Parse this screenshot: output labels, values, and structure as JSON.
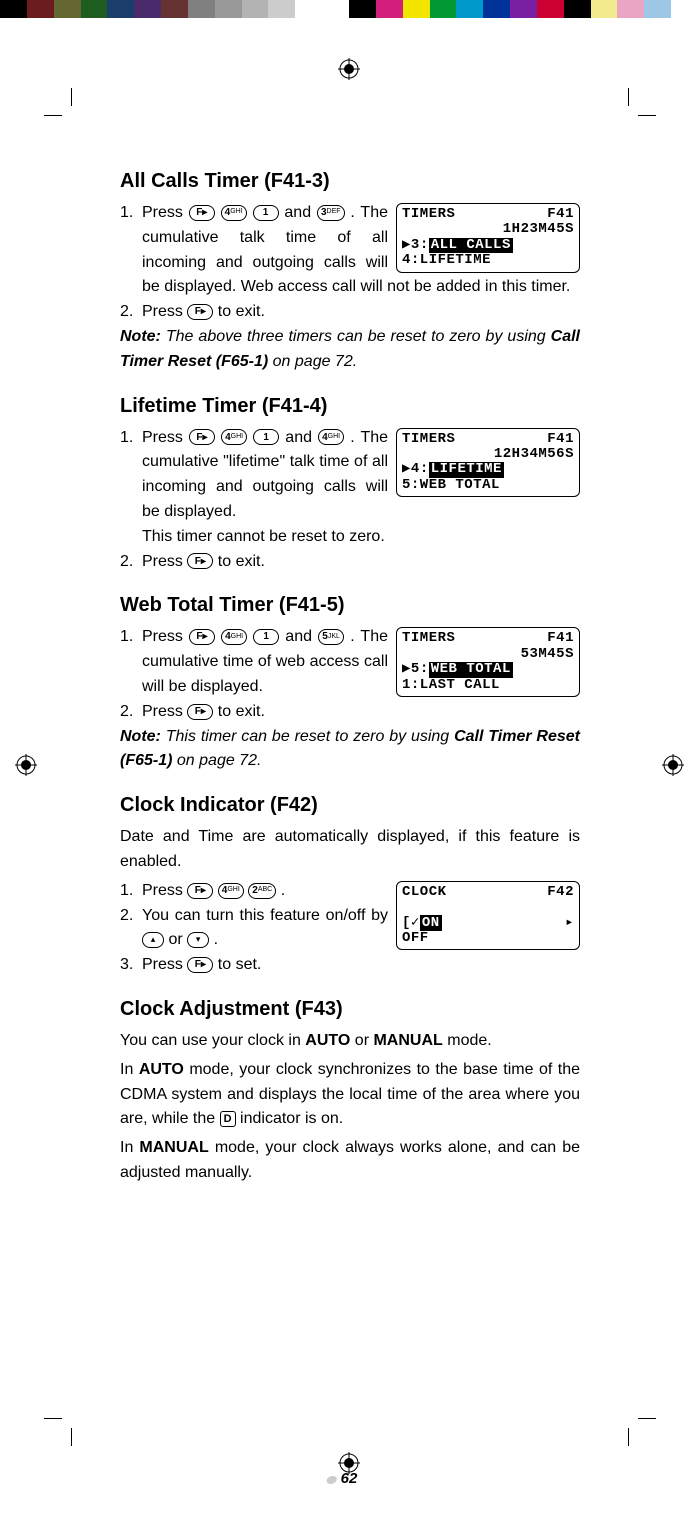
{
  "colorbar": [
    "#000000",
    "#6b1d1d",
    "#666633",
    "#1f5c1f",
    "#1a3d6b",
    "#4b2a6b",
    "#663333",
    "#808080",
    "#999999",
    "#b3b3b3",
    "#cccccc",
    "#ffffff",
    "#ffffff",
    "#000000",
    "#d21f7c",
    "#f2e600",
    "#009933",
    "#0099cc",
    "#003399",
    "#7a1fa2",
    "#cc0033",
    "#000000",
    "#f2ea8c",
    "#e8a6c4",
    "#9cc8e6",
    "#ffffff"
  ],
  "s1": {
    "title": "All Calls Timer (F41-3)",
    "step1a": "Press ",
    "step1b": " and ",
    "step1c": " . The cumulative talk time of all incoming and outgoing calls will be displayed. Web access call will not be added in this timer.",
    "step2a": "Press ",
    "step2b": " to exit.",
    "note_label": "Note:",
    "note_text": "  The above three timers can be reset to zero by using ",
    "note_bold": "Call Timer Reset (F65-1)",
    "note_tail": " on page 72.",
    "lcd": {
      "r1a": "TIMERS",
      "r1b": "F41",
      "r2": "1H23M45S",
      "r3p": "▶3:",
      "r3hl": "ALL CALLS",
      "r4": " 4:LIFETIME"
    }
  },
  "s2": {
    "title": "Lifetime Timer (F41-4)",
    "step1a": "Press ",
    "step1b": " and ",
    "step1c": " . The cumulative \"lifetime\" talk time of all incoming and outgoing calls will be displayed.",
    "step1d": "This timer cannot be reset to zero.",
    "step2a": "Press ",
    "step2b": " to exit.",
    "lcd": {
      "r1a": "TIMERS",
      "r1b": "F41",
      "r2": "12H34M56S",
      "r3p": "▶4:",
      "r3hl": "LIFETIME",
      "r4": " 5:WEB TOTAL"
    }
  },
  "s3": {
    "title": "Web Total Timer (F41-5)",
    "step1a": "Press ",
    "step1b": " and ",
    "step1c": " . The cumulative time of web access call will be displayed.",
    "step2a": "Press ",
    "step2b": " to exit.",
    "note_label": "Note:",
    "note_text": " This timer can be reset to zero by using ",
    "note_bold": "Call Timer Reset (F65-1)",
    "note_tail": " on page 72.",
    "lcd": {
      "r1a": "TIMERS",
      "r1b": "F41",
      "r2": "53M45S",
      "r3p": "▶5:",
      "r3hl": "WEB TOTAL",
      "r4": " 1:LAST CALL"
    }
  },
  "s4": {
    "title": "Clock Indicator (F42)",
    "intro": "Date and Time are automatically displayed, if this feature is enabled.",
    "step1a": "Press ",
    "step1b": " .",
    "step2a": "You can turn this feature on/off by ",
    "step2b": " or ",
    "step2c": " .",
    "step3a": "Press ",
    "step3b": " to set.",
    "lcd": {
      "r1a": "CLOCK",
      "r1b": "F42",
      "r3a": "[✓",
      "r3hl": "ON",
      "r3b": "▸",
      "r4": "  OFF"
    }
  },
  "s5": {
    "title": "Clock Adjustment (F43)",
    "p1a": "You can use your clock in ",
    "p1_auto": "AUTO",
    "p1b": " or ",
    "p1_manual": "MANUAL",
    "p1c": " mode.",
    "p2a": "In ",
    "p2_auto": "AUTO",
    "p2b": " mode, your clock synchronizes to the base time of the CDMA system and displays the local time of the area where you are, while the ",
    "d_icon": "D",
    "p2c": " indicator is on.",
    "p3a": "In ",
    "p3_manual": "MANUAL",
    "p3b": " mode, your clock always works alone, and can be adjusted manually."
  },
  "keys": {
    "F": "F▸",
    "1": "1",
    "2abc": "2",
    "2abc_sup": "ABC",
    "3def": "3",
    "3def_sup": "DEF",
    "4ghi": "4",
    "4ghi_sup": "GHI",
    "5jkl": "5",
    "5jkl_sup": "JKL",
    "up": "▴",
    "down": "▾"
  },
  "pagenum": "62"
}
